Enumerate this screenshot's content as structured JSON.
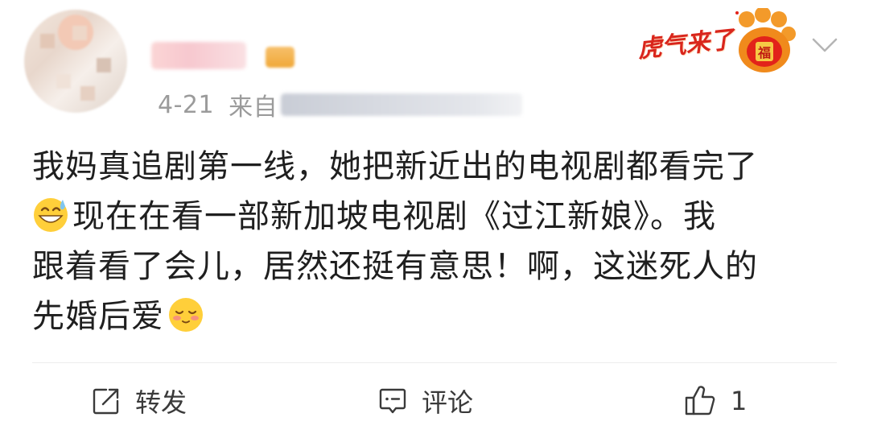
{
  "post": {
    "date": "4-21",
    "source_label": "来自",
    "festive_badge": "虎气来了",
    "content_lines": [
      "我妈真追剧第一线，她把新近出的电视剧都看完了",
      "现在在看一部新加坡电视剧《过江新娘》。我",
      "跟着看了会儿，居然还挺有意思！啊，这迷死人的",
      "先婚后爱"
    ],
    "icons": {
      "grin_sweat": "grinning-face-with-sweat-emoji",
      "shy_smile": "smiling-face-with-closed-eyes-emoji",
      "paw": "tiger-paw-fu-icon",
      "chevron": "chevron-down-icon"
    }
  },
  "actions": {
    "repost_label": "转发",
    "comment_label": "评论",
    "like_count": "1"
  },
  "colors": {
    "festive_red": "#d9261c",
    "meta_gray": "#9b9b9b",
    "icon_gray": "#3a3a3a"
  }
}
